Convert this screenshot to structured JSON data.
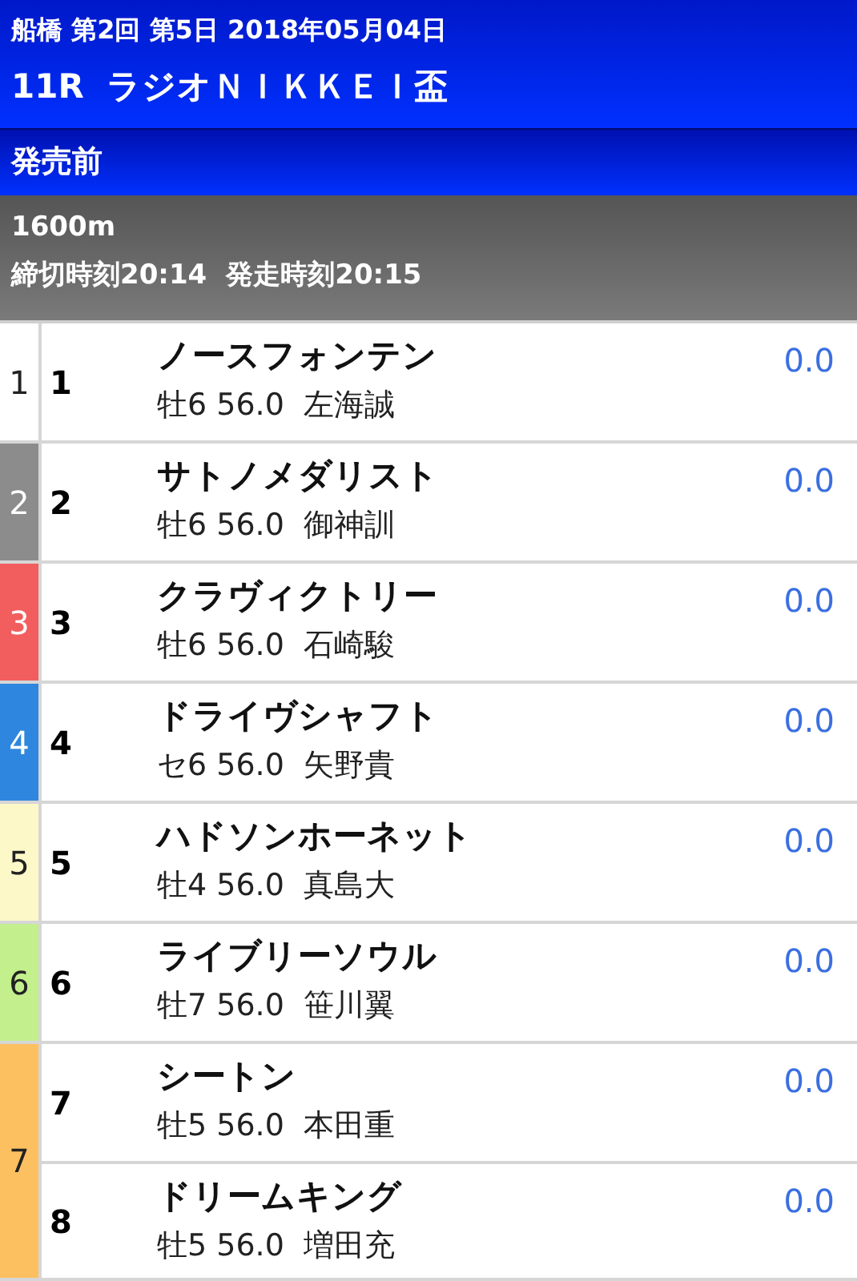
{
  "header": {
    "meeting": "船橋 第2回 第5日 2018年05月04日",
    "race_number": "11R",
    "race_name": "ラジオＮＩＫＫＥＩ盃"
  },
  "status": "発売前",
  "info": {
    "distance": "1600m",
    "deadline": "締切時刻20:14",
    "post_time": "発走時刻20:15"
  },
  "brackets": [
    {
      "number": "1",
      "color": "#ffffff",
      "horses": [
        {
          "number": "1",
          "name": "ノースフォンテン",
          "details": "牡6 56.0",
          "jockey": "左海誠",
          "odds": "0.0"
        }
      ]
    },
    {
      "number": "2",
      "color": "#8c8c8c",
      "horses": [
        {
          "number": "2",
          "name": "サトノメダリスト",
          "details": "牡6 56.0",
          "jockey": "御神訓",
          "odds": "0.0"
        }
      ]
    },
    {
      "number": "3",
      "color": "#f25e5e",
      "horses": [
        {
          "number": "3",
          "name": "クラヴィクトリー",
          "details": "牡6 56.0",
          "jockey": "石崎駿",
          "odds": "0.0"
        }
      ]
    },
    {
      "number": "4",
      "color": "#2e86de",
      "horses": [
        {
          "number": "4",
          "name": "ドライヴシャフト",
          "details": "セ6 56.0",
          "jockey": "矢野貴",
          "odds": "0.0"
        }
      ]
    },
    {
      "number": "5",
      "color": "#fdf8c8",
      "horses": [
        {
          "number": "5",
          "name": "ハドソンホーネット",
          "details": "牡4 56.0",
          "jockey": "真島大",
          "odds": "0.0"
        }
      ]
    },
    {
      "number": "6",
      "color": "#c3ef8c",
      "horses": [
        {
          "number": "6",
          "name": "ライブリーソウル",
          "details": "牡7 56.0",
          "jockey": "笹川翼",
          "odds": "0.0"
        }
      ]
    },
    {
      "number": "7",
      "color": "#fcc061",
      "horses": [
        {
          "number": "7",
          "name": "シートン",
          "details": "牡5 56.0",
          "jockey": "本田重",
          "odds": "0.0"
        },
        {
          "number": "8",
          "name": "ドリームキング",
          "details": "牡5 56.0",
          "jockey": "増田充",
          "odds": "0.0"
        }
      ]
    }
  ]
}
